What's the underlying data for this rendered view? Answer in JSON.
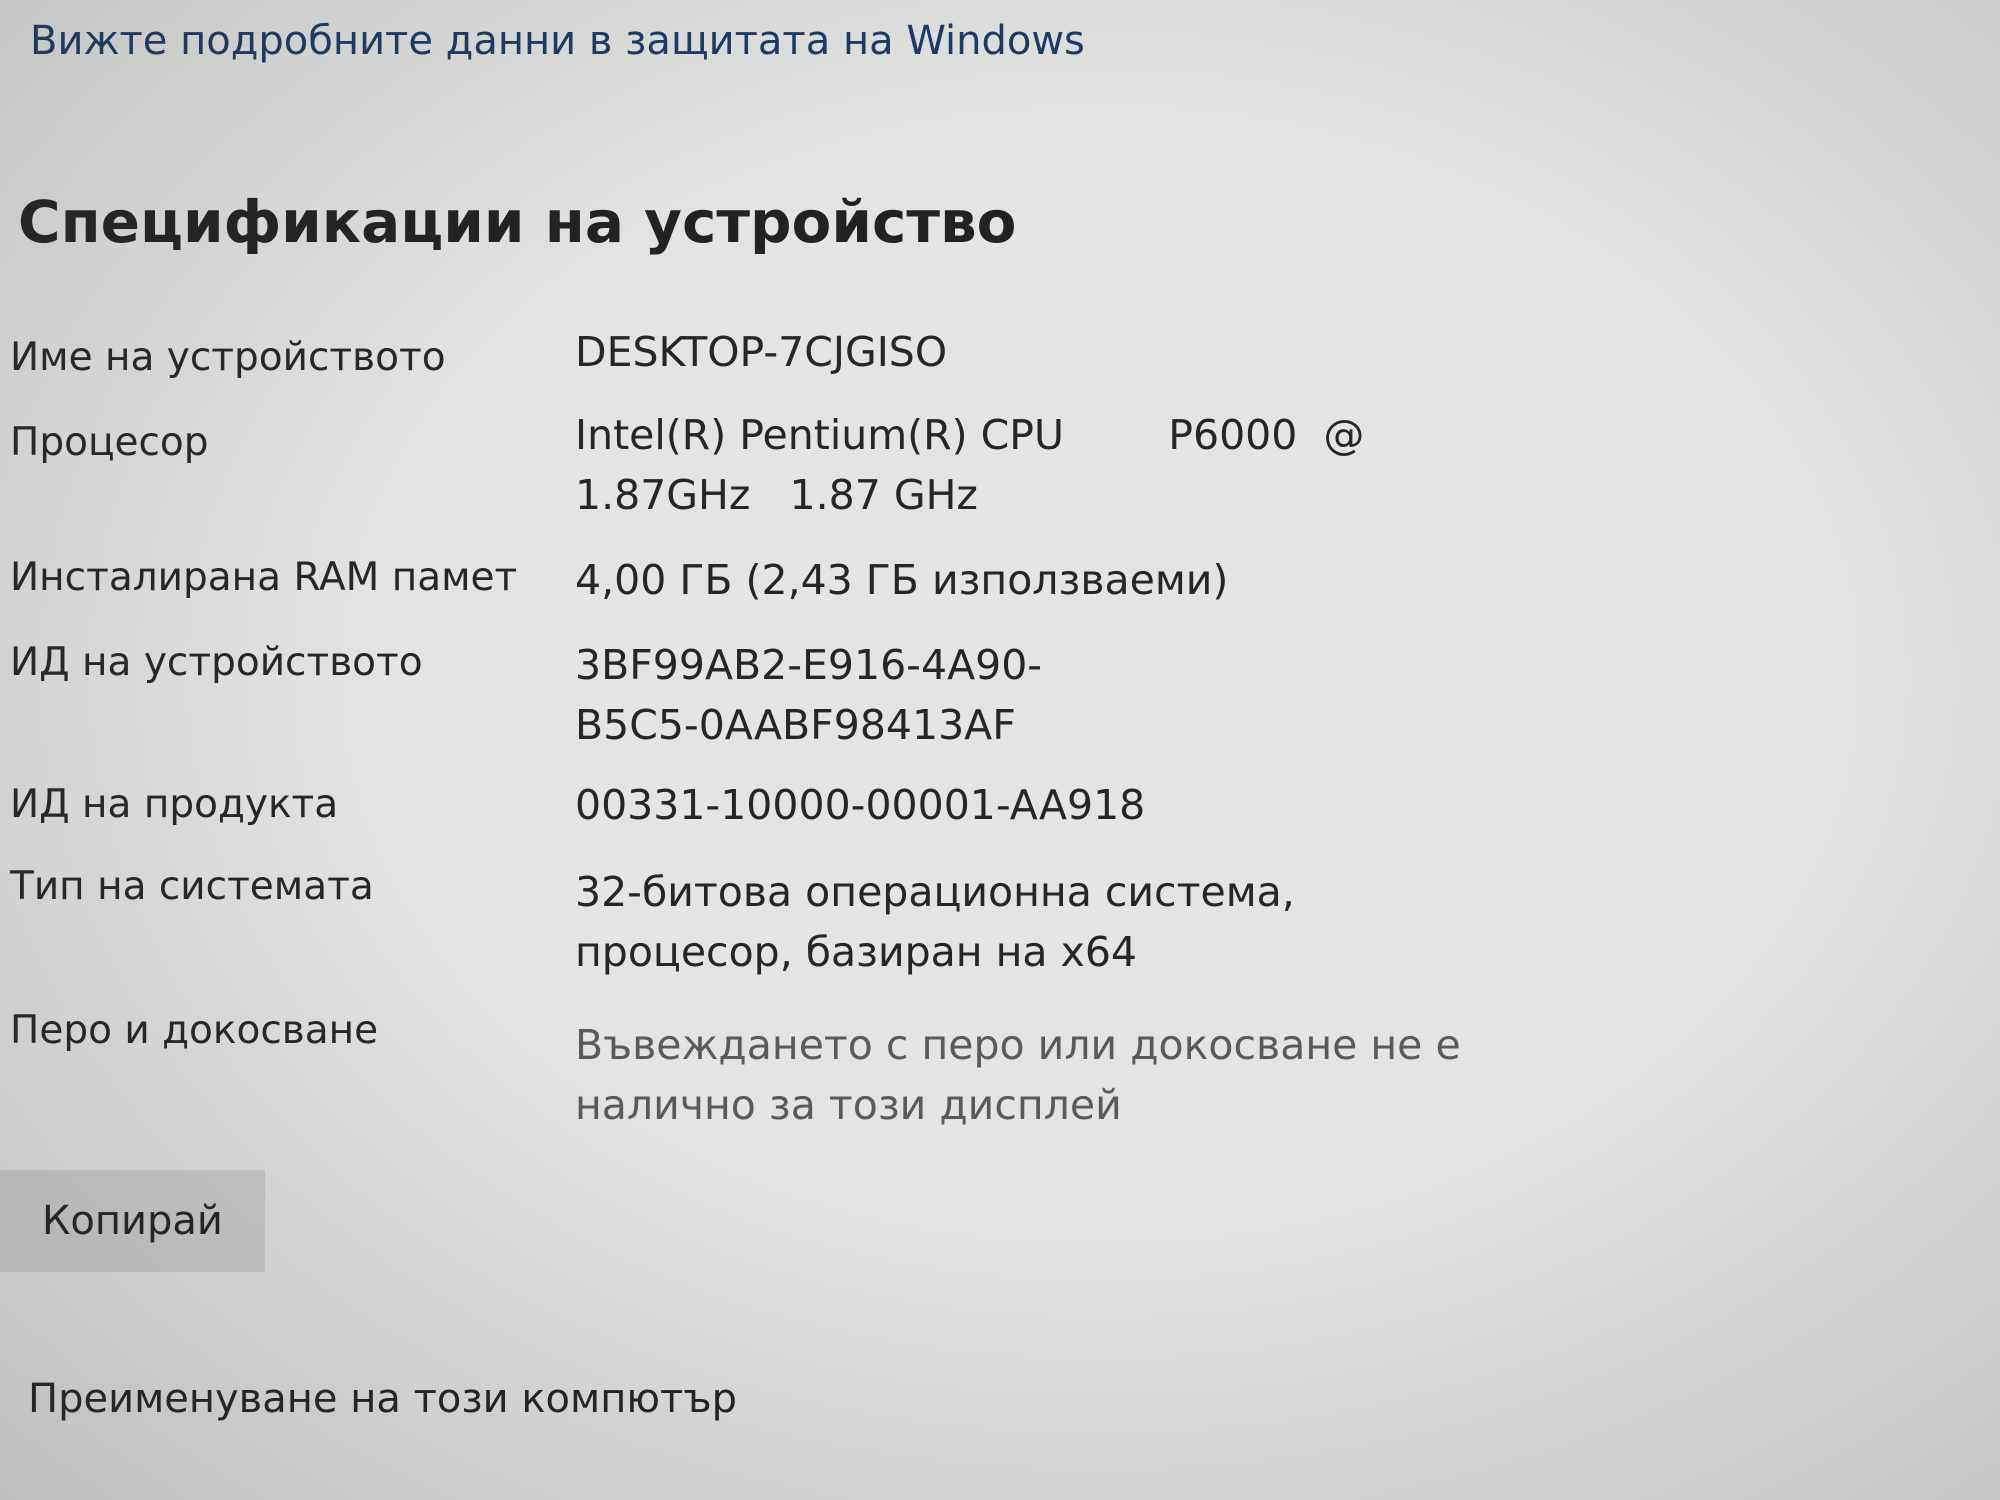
{
  "top_link": "Вижте подробните данни в защитата на Windows",
  "section_title": "Спецификации на устройство",
  "specs": [
    {
      "label": "Име на устройството",
      "value": "DESKTOP-7CJGISO"
    },
    {
      "label": "Процесор",
      "value": "Intel(R) Pentium(R) CPU        P6000  @\n1.87GHz   1.87 GHz"
    },
    {
      "label": "Инсталирана RAM памет",
      "value": "4,00 ГБ (2,43 ГБ използваеми)"
    },
    {
      "label": "ИД на устройството",
      "value": "3BF99AB2-E916-4A90-\nB5C5-0AABF98413AF"
    },
    {
      "label": "ИД на продукта",
      "value": "00331-10000-00001-AA918"
    },
    {
      "label": "Тип на системата",
      "value": "32-битова операционна система,\nпроцесор, базиран на x64"
    },
    {
      "label": "Перо и докосване",
      "value": "Въвеждането с перо или докосване не е\nналично за този дисплей"
    }
  ],
  "copy_button": "Копирай",
  "rename_link": "Преименуване на този компютър"
}
